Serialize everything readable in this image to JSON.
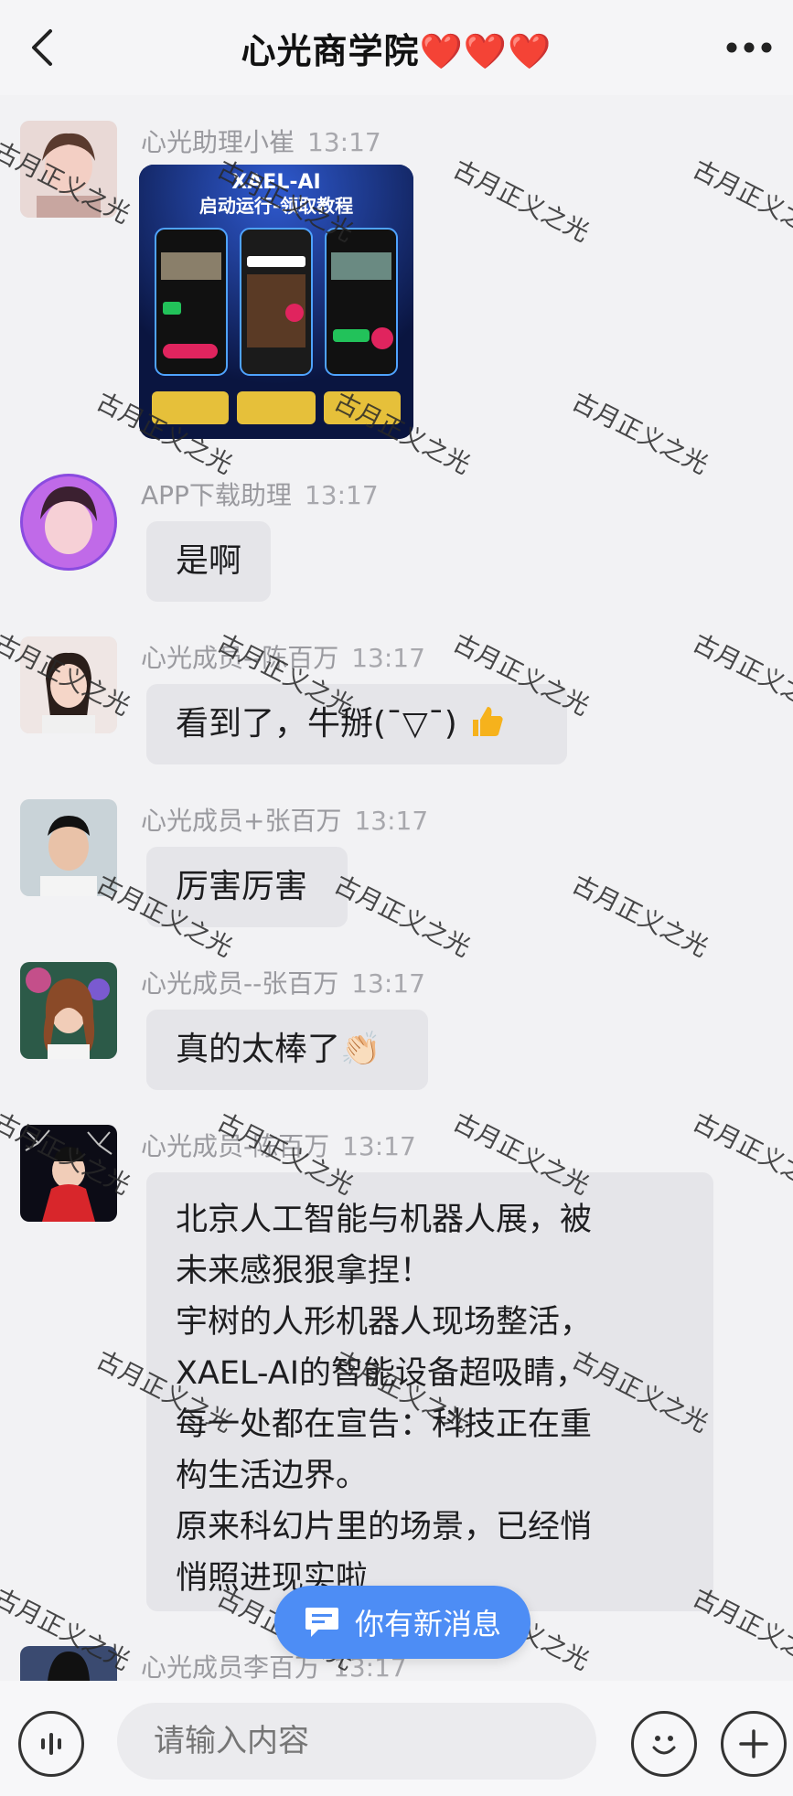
{
  "header": {
    "title": "心光商学院❤️❤️❤️"
  },
  "messages": [
    {
      "sender": "心光助理小崔",
      "time": "13:17",
      "type": "image",
      "image": {
        "title_line1": "XAEL-AI",
        "title_line2": "启动运行-领取教程"
      }
    },
    {
      "sender": "APP下载助理",
      "time": "13:17",
      "type": "text",
      "text": "是啊"
    },
    {
      "sender": "心光成员--陈百万",
      "time": "13:17",
      "type": "text",
      "text": "看到了，牛掰(¯▽¯)"
    },
    {
      "sender": "心光成员+张百万",
      "time": "13:17",
      "type": "text",
      "text": "厉害厉害"
    },
    {
      "sender": "心光成员--张百万",
      "time": "13:17",
      "type": "text",
      "text": "真的太棒了👏🏻"
    },
    {
      "sender": "心光成员-陈百万",
      "time": "13:17",
      "type": "text",
      "lines": [
        "北京人工智能与机器人展，被",
        "未来感狠狠拿捏！",
        "宇树的人形机器人现场整活，",
        "XAEL-AI的智能设备超吸睛，",
        "每一处都在宣告：科技正在重",
        "构生活边界。",
        "原来科幻片里的场景，已经悄",
        "悄照进现实啦"
      ]
    },
    {
      "sender": "心光成员李百万",
      "time": "13:17",
      "type": "partial"
    }
  ],
  "watermark_text": "古月正义之光",
  "toast": {
    "label": "你有新消息"
  },
  "composer": {
    "placeholder": "请输入内容"
  },
  "colors": {
    "toast": "#4d8df5",
    "bubble": "#e5e5e9",
    "background": "#f2f2f4",
    "thumb": "#f6b21c"
  },
  "icons": [
    "back-icon",
    "more-icon",
    "voice-icon",
    "emoji-icon",
    "plus-icon",
    "message-icon",
    "thumbs-up-icon"
  ]
}
